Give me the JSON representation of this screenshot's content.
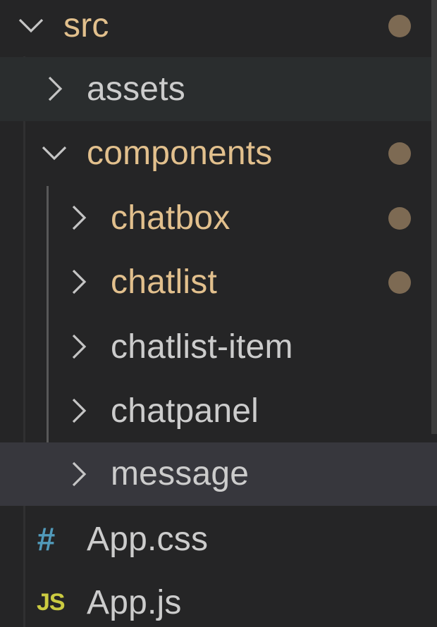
{
  "colors": {
    "background": "#252526",
    "hover_row": "#2a2d2e",
    "selected_row": "#37373d",
    "modified_text": "#e2c08d",
    "normal_text": "#cccccc",
    "chevron": "#c5c5c5",
    "modified_dot": "#7d6a53",
    "indent_guide": "#585858",
    "css_icon": "#519aba",
    "js_icon": "#cbcb41"
  },
  "tree": {
    "src": {
      "label": "src",
      "state": "expanded",
      "modified": true,
      "dot_icon": "modified-dot-icon"
    },
    "assets": {
      "label": "assets",
      "state": "collapsed",
      "modified": false
    },
    "components": {
      "label": "components",
      "state": "expanded",
      "modified": true
    },
    "chatbox": {
      "label": "chatbox",
      "state": "collapsed",
      "modified": true
    },
    "chatlist": {
      "label": "chatlist",
      "state": "collapsed",
      "modified": true
    },
    "chatlist_item": {
      "label": "chatlist-item",
      "state": "collapsed",
      "modified": false
    },
    "chatpanel": {
      "label": "chatpanel",
      "state": "collapsed",
      "modified": false
    },
    "message": {
      "label": "message",
      "state": "collapsed",
      "modified": false,
      "selected": true
    },
    "app_css": {
      "label": "App.css",
      "icon_glyph": "#",
      "icon": "css-file-icon"
    },
    "app_js": {
      "label": "App.js",
      "icon_glyph": "JS",
      "icon": "js-file-icon"
    }
  }
}
